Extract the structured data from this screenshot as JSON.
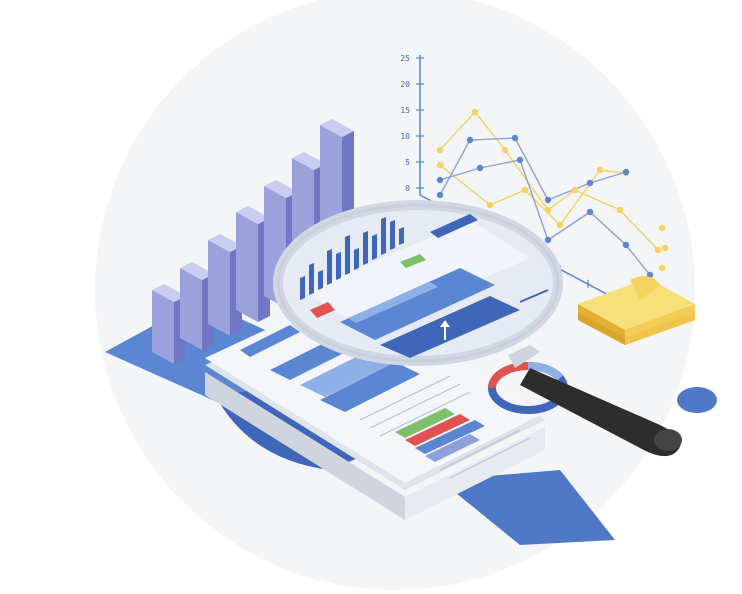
{
  "illustration": {
    "axis_ticks": [
      "25",
      "20",
      "15",
      "10",
      "5",
      "0"
    ],
    "colors": {
      "blue_dark": "#3f66b8",
      "blue_mid": "#5b86d1",
      "blue_light": "#8fb0e6",
      "bar_front": "#9aa1db",
      "bar_side": "#6f77c6",
      "bar_top": "#c9cdf0",
      "yellow": "#f4d35e",
      "sticky_top": "#f7e07a",
      "green": "#7cc06a",
      "red": "#e35151",
      "handle": "#2d2d2d",
      "paper": "#eef1f7",
      "background_disc": "#f2f3f5"
    },
    "icons": [
      "bar-chart-icon",
      "line-chart-icon",
      "magnifier-icon",
      "report-document-icon",
      "sticky-notes-icon",
      "donut-chart-icon"
    ]
  }
}
